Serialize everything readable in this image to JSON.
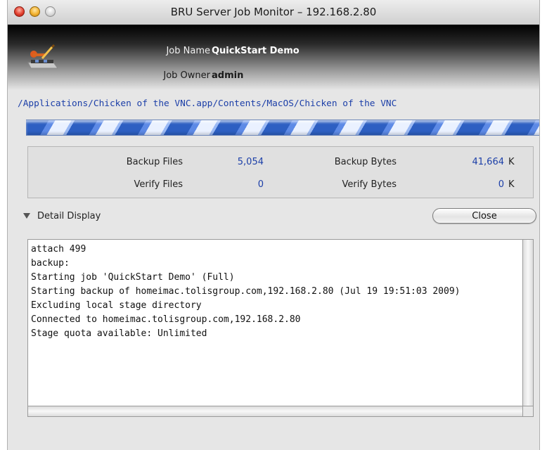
{
  "window": {
    "title": "BRU Server Job Monitor – 192.168.2.80"
  },
  "header": {
    "job_name_label": "Job Name",
    "job_name_value": "QuickStart Demo",
    "job_owner_label": "Job Owner",
    "job_owner_value": "admin",
    "icon": "bru-server-icon"
  },
  "current_file": "/Applications/Chicken of the VNC.app/Contents/MacOS/Chicken of the VNC",
  "progress": {
    "indeterminate": true,
    "color": "#2d5fc2"
  },
  "stats": {
    "backup_files_label": "Backup Files",
    "backup_files_value": "5,054",
    "backup_bytes_label": "Backup Bytes",
    "backup_bytes_value": "41,664",
    "backup_bytes_unit": "K",
    "verify_files_label": "Verify Files",
    "verify_files_value": "0",
    "verify_bytes_label": "Verify Bytes",
    "verify_bytes_value": "0",
    "verify_bytes_unit": "K"
  },
  "detail": {
    "toggle_label": "Detail Display",
    "expanded": true,
    "close_label": "Close"
  },
  "log": {
    "lines": [
      "attach 499",
      "backup:",
      "Starting job 'QuickStart Demo' (Full)",
      "Starting backup of homeimac.tolisgroup.com,192.168.2.80 (Jul 19 19:51:03 2009)",
      "Excluding local stage directory",
      "Connected to homeimac.tolisgroup.com,192.168.2.80",
      "Stage quota available: Unlimited"
    ]
  },
  "colors": {
    "accent": "#1c3fa8",
    "window_bg": "#e6e6e6"
  }
}
